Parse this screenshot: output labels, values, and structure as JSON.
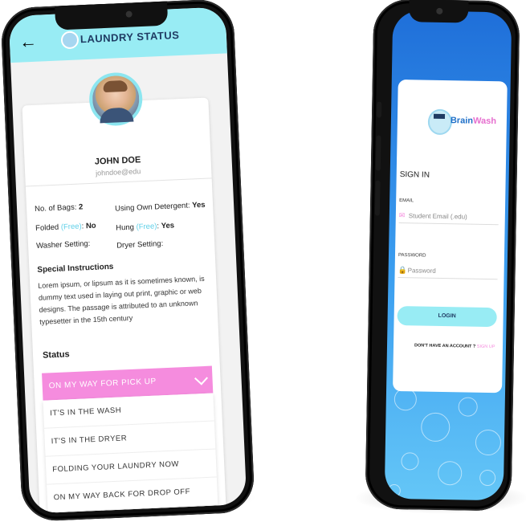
{
  "left_phone": {
    "header": {
      "title": "LAUNDRY STATUS"
    },
    "profile": {
      "name": "JOHN DOE",
      "email": "johndoe@edu"
    },
    "details": {
      "bags_label": "No. of Bags:",
      "bags_value": "2",
      "detergent_label": "Using Own Detergent:",
      "detergent_value": "Yes",
      "folded_label": "Folded",
      "folded_free": "(Free)",
      "folded_value": "No",
      "hung_label": "Hung",
      "hung_free": "(Free)",
      "hung_value": "Yes",
      "washer_label": "Washer Setting:",
      "dryer_label": "Dryer Setting:"
    },
    "special": {
      "title": "Special Instructions",
      "text": "Lorem ipsum, or lipsum as it is sometimes known, is dummy text used in laying out print, graphic or web designs. The passage is attributed to an unknown typesetter in the 15th century"
    },
    "status": {
      "label": "Status",
      "selected": "ON MY WAY FOR PICK UP",
      "options": [
        "IT'S IN THE WASH",
        "IT'S IN THE DRYER",
        "FOLDING YOUR LAUNDRY NOW",
        "ON MY WAY BACK FOR DROP OFF"
      ]
    }
  },
  "right_phone": {
    "brand": {
      "name_a": "Brain",
      "name_b": "Wash"
    },
    "signin_title": "SIGN IN",
    "email": {
      "label": "EMAIL",
      "placeholder": "Student Email (.edu)"
    },
    "password": {
      "label": "PASSWORD",
      "placeholder": "Password"
    },
    "login_label": "LOGIN",
    "no_account": "DON'T HAVE AN ACCOUNT ?",
    "signup": "SIGN UP"
  },
  "colors": {
    "header": "#98ecf4",
    "dropdown": "#f58cde",
    "accent": "#5fd0e8",
    "screen_bg": "#1f6fd9"
  }
}
